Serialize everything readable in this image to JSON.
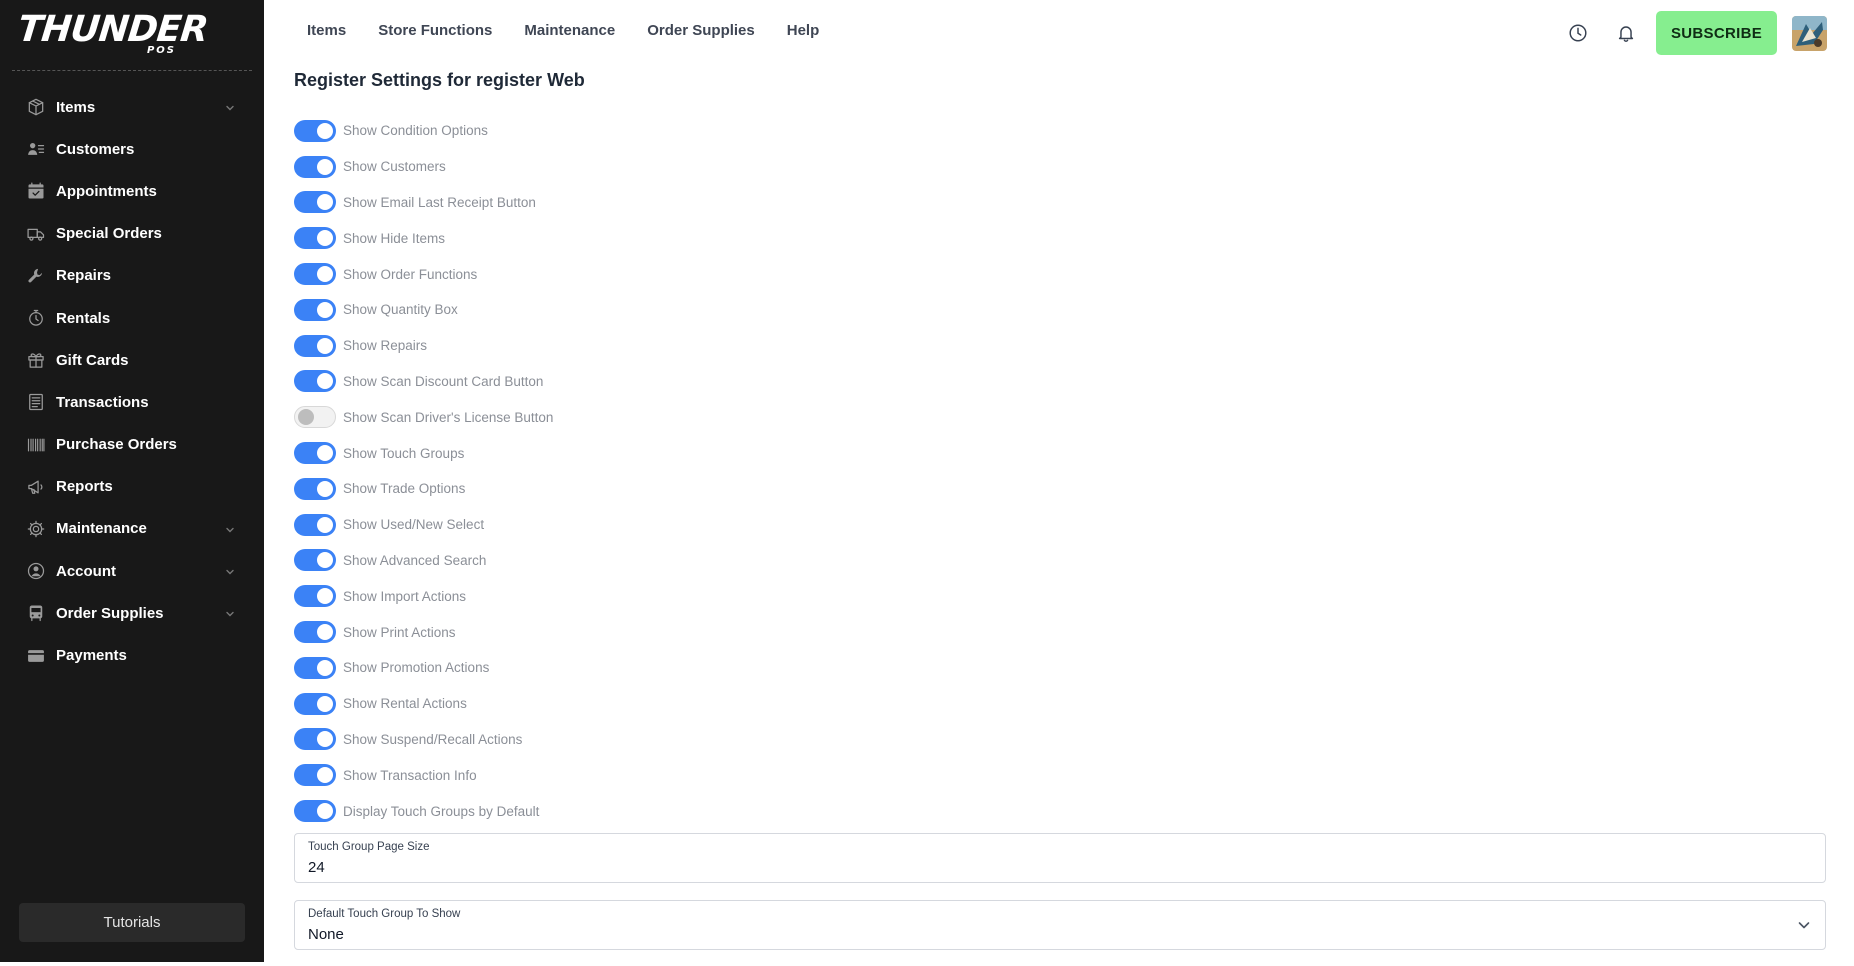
{
  "brand": {
    "name": "THUNDER",
    "sub": "POS"
  },
  "sidebar": {
    "items": [
      {
        "label": "Items",
        "icon": "box-icon",
        "has_chevron": true
      },
      {
        "label": "Customers",
        "icon": "customers-icon",
        "has_chevron": false
      },
      {
        "label": "Appointments",
        "icon": "calendar-icon",
        "has_chevron": false
      },
      {
        "label": "Special Orders",
        "icon": "truck-icon",
        "has_chevron": false
      },
      {
        "label": "Repairs",
        "icon": "wrench-icon",
        "has_chevron": false
      },
      {
        "label": "Rentals",
        "icon": "stopwatch-icon",
        "has_chevron": false
      },
      {
        "label": "Gift Cards",
        "icon": "gift-icon",
        "has_chevron": false
      },
      {
        "label": "Transactions",
        "icon": "receipt-icon",
        "has_chevron": false
      },
      {
        "label": "Purchase Orders",
        "icon": "barcode-icon",
        "has_chevron": false
      },
      {
        "label": "Reports",
        "icon": "megaphone-icon",
        "has_chevron": false
      },
      {
        "label": "Maintenance",
        "icon": "gear-icon",
        "has_chevron": true
      },
      {
        "label": "Account",
        "icon": "user-circle-icon",
        "has_chevron": true
      },
      {
        "label": "Order Supplies",
        "icon": "bus-icon",
        "has_chevron": true
      },
      {
        "label": "Payments",
        "icon": "credit-card-icon",
        "has_chevron": false
      }
    ],
    "tutorials_label": "Tutorials"
  },
  "header": {
    "nav": [
      "Items",
      "Store Functions",
      "Maintenance",
      "Order Supplies",
      "Help"
    ],
    "subscribe_label": "SUBSCRIBE"
  },
  "main": {
    "title": "Register Settings for register Web",
    "toggles": [
      {
        "label": "Show Condition Options",
        "on": true
      },
      {
        "label": "Show Customers",
        "on": true
      },
      {
        "label": "Show Email Last Receipt Button",
        "on": true
      },
      {
        "label": "Show Hide Items",
        "on": true
      },
      {
        "label": "Show Order Functions",
        "on": true
      },
      {
        "label": "Show Quantity Box",
        "on": true
      },
      {
        "label": "Show Repairs",
        "on": true
      },
      {
        "label": "Show Scan Discount Card Button",
        "on": true
      },
      {
        "label": "Show Scan Driver's License Button",
        "on": false
      },
      {
        "label": "Show Touch Groups",
        "on": true
      },
      {
        "label": "Show Trade Options",
        "on": true
      },
      {
        "label": "Show Used/New Select",
        "on": true
      },
      {
        "label": "Show Advanced Search",
        "on": true
      },
      {
        "label": "Show Import Actions",
        "on": true
      },
      {
        "label": "Show Print Actions",
        "on": true
      },
      {
        "label": "Show Promotion Actions",
        "on": true
      },
      {
        "label": "Show Rental Actions",
        "on": true
      },
      {
        "label": "Show Suspend/Recall Actions",
        "on": true
      },
      {
        "label": "Show Transaction Info",
        "on": true
      },
      {
        "label": "Display Touch Groups by Default",
        "on": true
      }
    ],
    "page_size": {
      "label": "Touch Group Page Size",
      "value": "24"
    },
    "default_group": {
      "label": "Default Touch Group To Show",
      "value": "None"
    }
  },
  "colors": {
    "sidebar_bg": "#181818",
    "accent": "#3b82f6",
    "subscribe_bg": "#86ee8f"
  }
}
